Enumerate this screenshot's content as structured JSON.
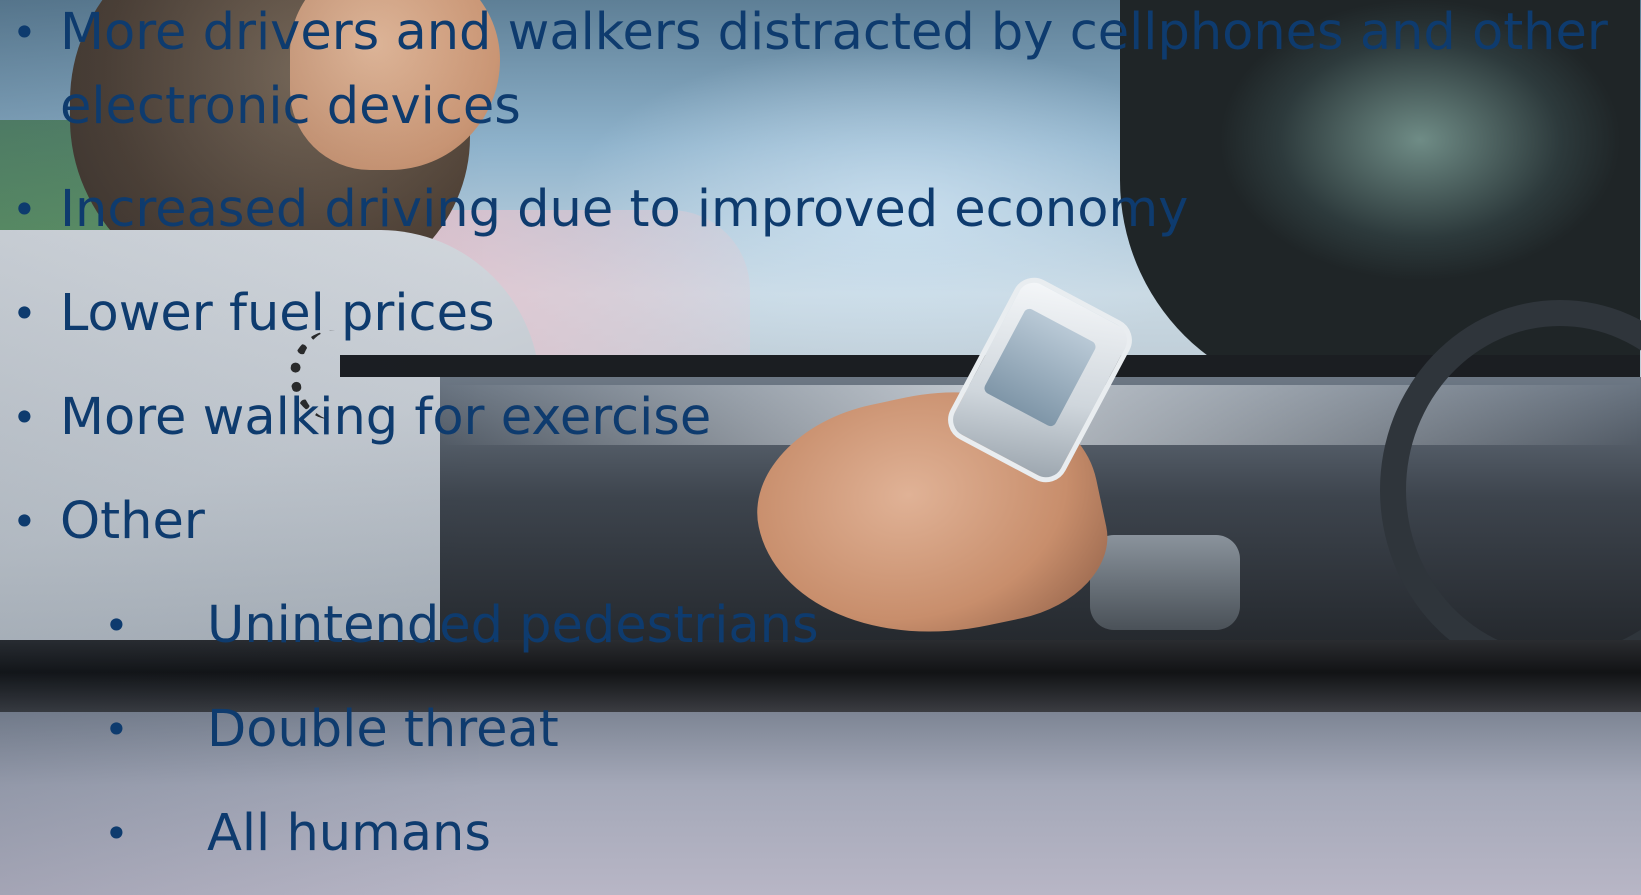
{
  "slide": {
    "bullets": [
      {
        "marker": "•",
        "lines": [
          "More drivers and walkers distracted by cellphones and other",
          "electronic devices"
        ]
      },
      {
        "marker": "•",
        "text": "Increased driving due to improved economy"
      },
      {
        "marker": "•",
        "text": "Lower fuel prices"
      },
      {
        "marker": "•",
        "text": "More walking for exercise"
      },
      {
        "marker": "•",
        "text": "Other",
        "sub_bullets": [
          {
            "marker": "•",
            "text": "Unintended pedestrians"
          },
          {
            "marker": "•",
            "text": "Double threat"
          },
          {
            "marker": "•",
            "text": "All humans"
          }
        ]
      }
    ]
  },
  "colors": {
    "text": "#0e3b6e"
  },
  "background_image": {
    "icon": "photo-driver-texting-on-phone"
  }
}
